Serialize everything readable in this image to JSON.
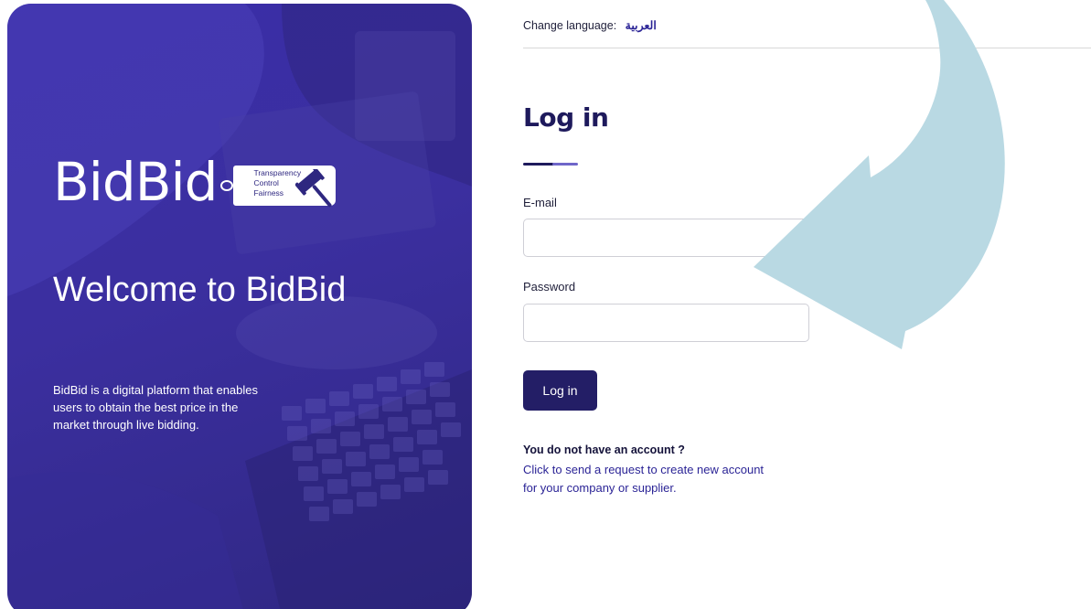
{
  "hero": {
    "brand_name": "BidBid",
    "brand_tag": [
      "Transparency",
      "Control",
      "Fairness"
    ],
    "welcome_title": "Welcome to BidBid",
    "description": "BidBid is a digital platform that enables users to obtain the best price in the market through live bidding."
  },
  "language": {
    "label": "Change language:",
    "option": "العربية"
  },
  "login": {
    "title": "Log in",
    "email_label": "E-mail",
    "email_value": "",
    "password_label": "Password",
    "password_value": "",
    "submit_label": "Log in"
  },
  "signup": {
    "question": "You do not have an account ?",
    "request_line1": "Click to send a request to create new account",
    "request_line2": "for your company or supplier."
  },
  "colors": {
    "hero_bg": "#3a2ea8",
    "primary_dark": "#231e66",
    "link": "#2b2496",
    "arrow": "#b9d9e3"
  },
  "icons": [
    "gavel-icon",
    "curved-arrow-icon"
  ]
}
